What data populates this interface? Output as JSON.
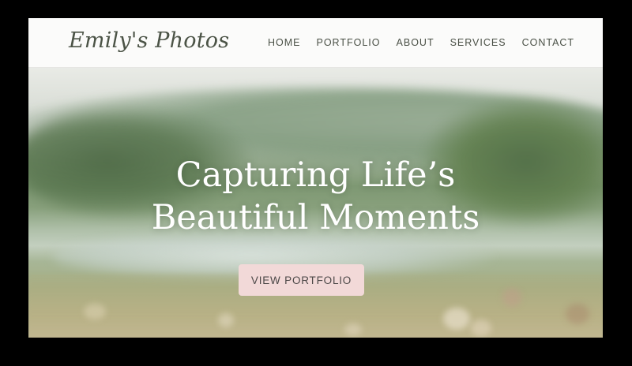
{
  "site": {
    "logo": "Emily's Photos"
  },
  "nav": {
    "items": [
      {
        "label": "HOME"
      },
      {
        "label": "PORTFOLIO"
      },
      {
        "label": "ABOUT"
      },
      {
        "label": "SERVICES"
      },
      {
        "label": "CONTACT"
      }
    ]
  },
  "hero": {
    "title_line_1": "Capturing Life’s",
    "title_line_2": "Beautiful Moments",
    "cta_label": "VIEW PORTFOLIO",
    "background_image": "blurred landscape with mountains, lake and meadow"
  },
  "colors": {
    "cta_background": "#f2d9d8",
    "nav_text": "#4a5046",
    "header_background": "#fbfbfa"
  }
}
